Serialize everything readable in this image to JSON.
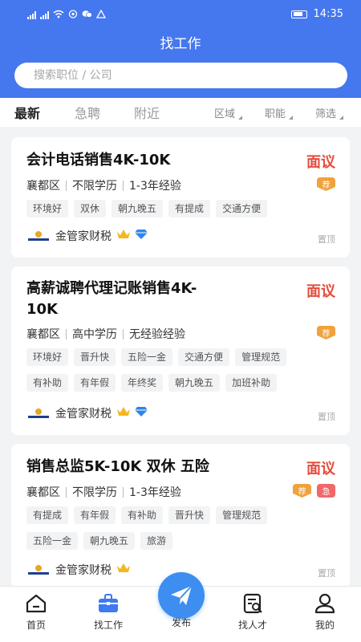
{
  "status_bar": {
    "time": "14:35",
    "network": "46",
    "network2": "46"
  },
  "header": {
    "title": "找工作"
  },
  "search": {
    "placeholder": "搜索职位 / 公司"
  },
  "tabs": [
    {
      "label": "最新"
    },
    {
      "label": "急聘"
    },
    {
      "label": "附近"
    }
  ],
  "filters": [
    {
      "label": "区域"
    },
    {
      "label": "职能"
    },
    {
      "label": "筛选"
    }
  ],
  "jobs": [
    {
      "title": "会计电话销售4K-10K",
      "salary": "面议",
      "district": "襄都区",
      "education": "不限学历",
      "experience": "1-3年经验",
      "badges": [
        "荐"
      ],
      "tags": [
        "环境好",
        "双休",
        "朝九晚五",
        "有提成",
        "交通方便"
      ],
      "company": "金管家财税",
      "pin": "置顶"
    },
    {
      "title_line1": "高薪诚聘代理记账销售4K-",
      "title_line2": "10K",
      "salary": "面议",
      "district": "襄都区",
      "education": "高中学历",
      "experience": "无经验经验",
      "badges": [
        "荐"
      ],
      "tags": [
        "环境好",
        "晋升快",
        "五险一金",
        "交通方便",
        "管理规范",
        "有补助",
        "有年假",
        "年终奖",
        "朝九晚五",
        "加班补助"
      ],
      "company": "金管家财税",
      "pin": "置顶"
    },
    {
      "title": "销售总监5K-10K 双休 五险",
      "salary": "面议",
      "district": "襄都区",
      "education": "不限学历",
      "experience": "1-3年经验",
      "badges": [
        "荐",
        "急"
      ],
      "tags": [
        "有提成",
        "有年假",
        "有补助",
        "晋升快",
        "管理规范",
        "五险一金",
        "朝九晚五",
        "旅游"
      ],
      "company": "金管家财税",
      "pin": "置顶"
    }
  ],
  "bottom_nav": [
    {
      "label": "首页",
      "icon": "home-icon"
    },
    {
      "label": "找工作",
      "icon": "briefcase-icon"
    },
    {
      "label": "发布",
      "icon": "paper-plane-icon"
    },
    {
      "label": "找人才",
      "icon": "search-resume-icon"
    },
    {
      "label": "我的",
      "icon": "user-icon"
    }
  ],
  "colors": {
    "primary": "#4577ee",
    "salary": "#e64c3c",
    "badge_jian": "#f0a23c",
    "badge_ji": "#f06868",
    "publish": "#3e8df0"
  }
}
